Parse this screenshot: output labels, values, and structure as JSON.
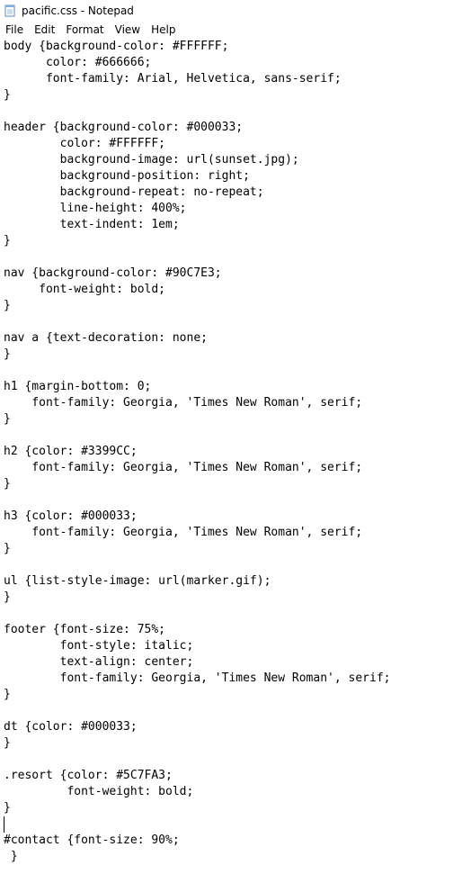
{
  "window": {
    "title": "pacific.css - Notepad"
  },
  "menu": [
    "File",
    "Edit",
    "Format",
    "View",
    "Help"
  ],
  "editor": {
    "content": "body {background-color: #FFFFFF;\n      color: #666666;\n      font-family: Arial, Helvetica, sans-serif;\n}\n\nheader {background-color: #000033;\n        color: #FFFFFF;\n        background-image: url(sunset.jpg);\n        background-position: right;\n        background-repeat: no-repeat;\n        line-height: 400%;\n        text-indent: 1em;\n}\n\nnav {background-color: #90C7E3;\n     font-weight: bold;\n}\n\nnav a {text-decoration: none;\n}\n\nh1 {margin-bottom: 0;\n    font-family: Georgia, 'Times New Roman', serif;\n}\n\nh2 {color: #3399CC;\n    font-family: Georgia, 'Times New Roman', serif;\n}\n\nh3 {color: #000033;\n    font-family: Georgia, 'Times New Roman', serif;\n}\n\nul {list-style-image: url(marker.gif);\n}\n\nfooter {font-size: 75%;\n        font-style: italic;\n        text-align: center;\n        font-family: Georgia, 'Times New Roman', serif;\n}\n\ndt {color: #000033;\n}\n\n.resort {color: #5C7FA3;\n         font-weight: bold;\n}\n\n#contact {font-size: 90%;\n }"
  }
}
